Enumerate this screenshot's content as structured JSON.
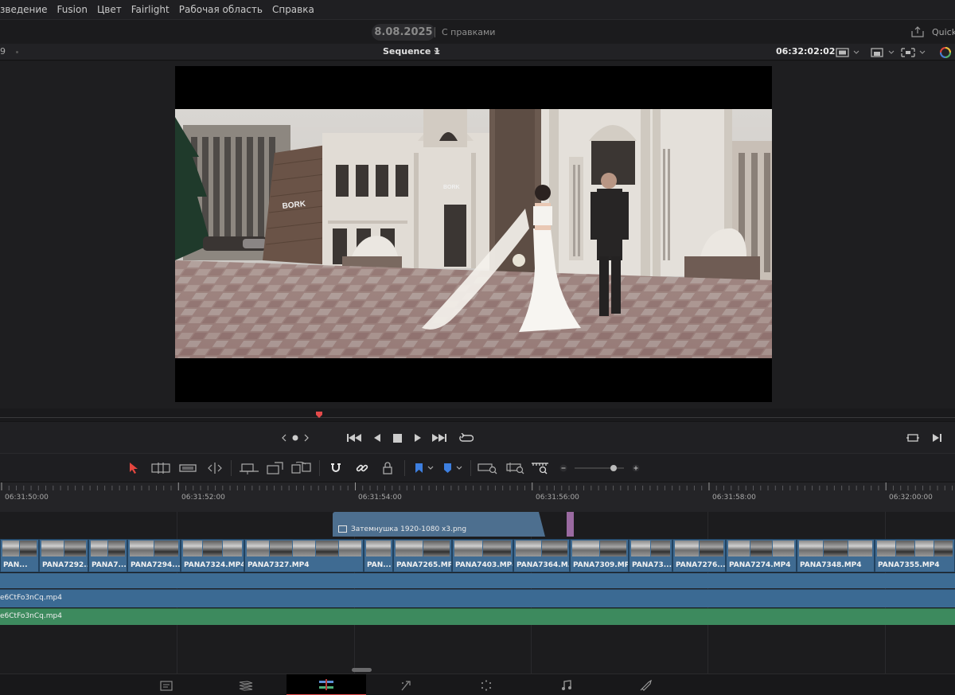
{
  "menu": {
    "items": [
      "зведение",
      "Fusion",
      "Цвет",
      "Fairlight",
      "Рабочая область",
      "Справка"
    ]
  },
  "titlebar": {
    "project_name": "8.08.2025",
    "status": "С правками",
    "quick_label": "Quick"
  },
  "viewer_header": {
    "left_label": "9",
    "sequence_title": "Sequence 1",
    "timecode": "06:32:02:02"
  },
  "ruler": {
    "labels": [
      "06:31:50:00",
      "06:31:52:00",
      "06:31:54:00",
      "06:31:56:00",
      "06:31:58:00",
      "06:32:00:00"
    ]
  },
  "timeline": {
    "v2_clip": "Затемнушка 1920-1080 x3.png",
    "v1_clips": [
      "PAN...",
      "PANA7292...",
      "PANA7...",
      "PANA7294...",
      "PANA7324.MP4",
      "PANA7327.MP4",
      "PAN...",
      "PANA7265.MP4",
      "PANA7403.MP4",
      "PANA7364.M...",
      "PANA7309.MP4",
      "PANA73...",
      "PANA7276...",
      "PANA7274.MP4",
      "PANA7348.MP4",
      "PANA7355.MP4"
    ],
    "a1_clip": "e6CtFo3nCq.mp4",
    "a2_clip": "e6CtFo3nCq.mp4"
  },
  "colors": {
    "video_clip": "#3f6b92",
    "audio_clip_green": "#3d8a5e",
    "overlay_clip": "#4d6f8f",
    "marker_purple": "#9a6aa1",
    "playhead": "#e44a4a"
  },
  "icons": {
    "transport": [
      "jog-left-icon",
      "jog-dot-icon",
      "jog-right-icon",
      "go-to-start-icon",
      "play-reverse-icon",
      "stop-icon",
      "play-icon",
      "go-to-end-icon",
      "loop-icon",
      "match-frame-icon",
      "next-frame-icon"
    ],
    "toolbar": [
      "selection-arrow-icon",
      "trim-tool-icon",
      "blade-tool-icon",
      "dynamic-trim-icon",
      "insert-clip-icon",
      "overwrite-clip-icon",
      "replace-clip-icon",
      "snapping-icon",
      "linked-selection-icon",
      "position-lock-icon",
      "flag-icon",
      "marker-icon",
      "zoom-full-icon",
      "zoom-detail-icon",
      "zoom-custom-icon",
      "zoom-out-icon",
      "zoom-in-icon"
    ],
    "pages": [
      "media-page-icon",
      "cut-page-icon",
      "edit-page-icon",
      "fusion-page-icon",
      "color-page-icon",
      "fairlight-page-icon",
      "deliver-page-icon"
    ]
  }
}
